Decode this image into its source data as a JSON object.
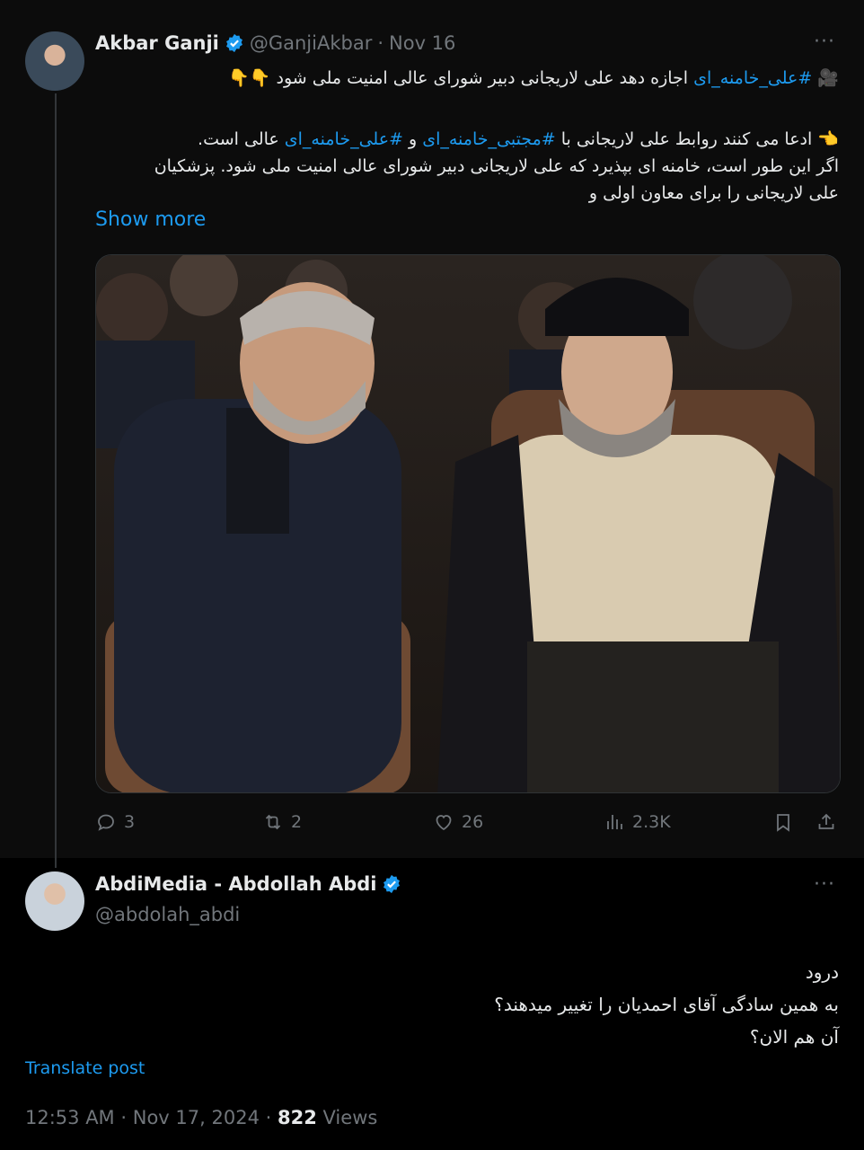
{
  "tweet": {
    "author_name": "Akbar Ganji",
    "handle": "@GanjiAkbar",
    "separator": "·",
    "date": "Nov 16",
    "line1_emoji": "🎥",
    "line1_tag": "#علی_خامنه_ای",
    "line1_text": " اجازه دهد علی لاریجانی دبیر شورای عالی امنیت ملی شود ",
    "line1_end": "👇👇",
    "p2_emoji": "👈",
    "p2_text1": " ادعا می کنند روابط علی لاریجانی با ",
    "p2_tag1": "#مجتبی_خامنه_ای",
    "p2_and": " و ",
    "p2_tag2": "#علی_خامنه_ای",
    "p2_text2": " عالی است.",
    "p3": "اگر این طور است، خامنه ای بپذیرد که علی لاریجانی دبیر شورای عالی امنیت ملی شود. پزشکیان علی لاریجانی را برای معاون اولی و",
    "show_more": "Show more",
    "stats": {
      "replies": "3",
      "reposts": "2",
      "likes": "26",
      "views": "2.3K"
    }
  },
  "reply": {
    "author_name": "AbdiMedia - Abdollah Abdi",
    "handle": "@abdolah_abdi",
    "line1": "درود",
    "line2": "به همین سادگی آقای احمدیان را تغییر میدهند؟",
    "line3": "آن هم الان؟",
    "translate": "Translate post",
    "time": "12:53 AM",
    "separator": "·",
    "date": "Nov 17, 2024",
    "views_count": "822",
    "views_label": "Views"
  },
  "colors": {
    "accent": "#1d9bf0",
    "muted": "#71767b",
    "text": "#e7e9ea",
    "background": "#000000"
  },
  "icons": [
    "verified-badge-icon",
    "more-icon",
    "reply-icon",
    "repost-icon",
    "like-icon",
    "views-icon",
    "bookmark-icon",
    "share-icon"
  ]
}
